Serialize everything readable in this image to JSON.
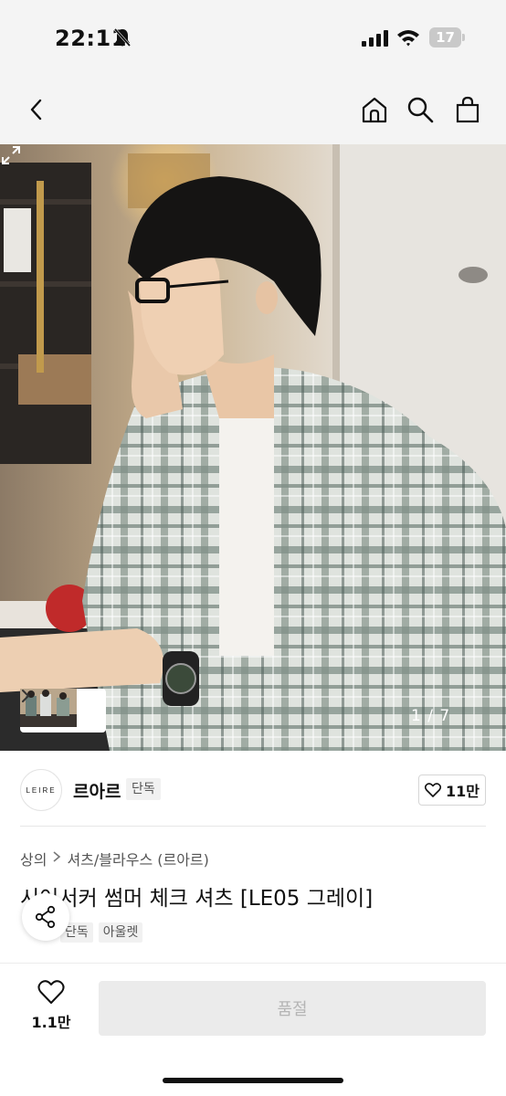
{
  "status_bar": {
    "time": "22:11",
    "battery": "17",
    "icons": [
      "bell-off-icon",
      "signal-icon",
      "wifi-icon",
      "battery-icon"
    ]
  },
  "nav": {
    "icons": [
      "back-chevron-icon",
      "home-icon",
      "search-icon",
      "shopping-bag-icon"
    ]
  },
  "gallery": {
    "page_indicator": "1 / 7",
    "current_page": 1,
    "total_pages": 7
  },
  "brand": {
    "logo_text": "LEIRE",
    "name": "르아르",
    "tag": "단독",
    "likes": "11만"
  },
  "breadcrumb": {
    "level1": "상의",
    "level2": "셔츠/블라우스 (르아르)"
  },
  "product": {
    "title": "시어서커 썸머 체크 셔츠 [LE05 그레이]",
    "tags": [
      "단독",
      "아울렛"
    ]
  },
  "bottom_bar": {
    "wish_count": "1.1만",
    "buy_label": "품절"
  }
}
